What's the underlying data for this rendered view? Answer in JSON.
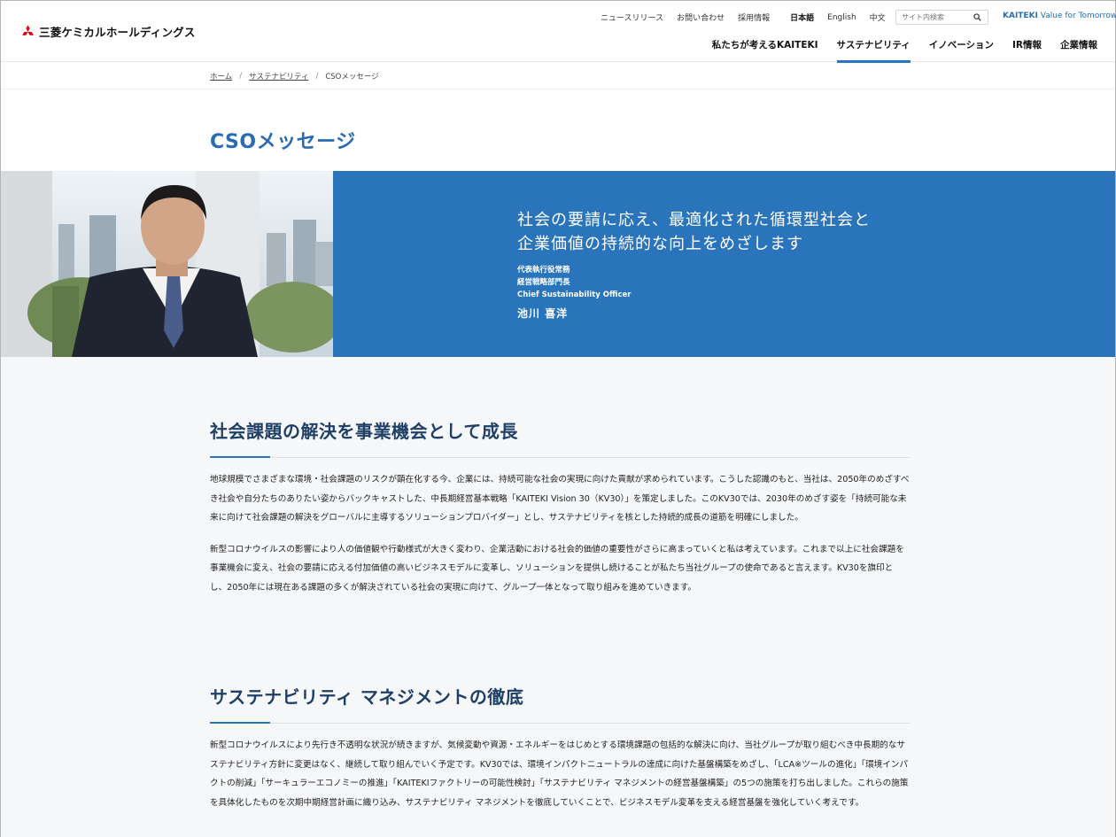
{
  "header": {
    "logo_text": "三菱ケミカルホールディングス",
    "utility_links": [
      "ニュースリリース",
      "お問い合わせ",
      "採用情報"
    ],
    "languages": [
      "日本語",
      "English",
      "中文"
    ],
    "active_language": "日本語",
    "search_placeholder": "サイト内検索",
    "tagline_brand": "KAITEKI",
    "tagline_rest": " Value for Tomorrow",
    "nav": [
      "私たちが考えるKAITEKI",
      "サステナビリティ",
      "イノベーション",
      "IR情報",
      "企業情報"
    ],
    "nav_current": "サステナビリティ"
  },
  "breadcrumb": [
    "ホーム",
    "サステナビリティ",
    "CSOメッセージ"
  ],
  "page_title": "CSOメッセージ",
  "hero": {
    "heading_line1": "社会の要請に応え、最適化された循環型社会と",
    "heading_line2": "企業価値の持続的な向上をめざします",
    "role1": "代表執行役常務",
    "role2": "経営戦略部門長",
    "role3": "Chief Sustainability Officer",
    "name": "池川 喜洋"
  },
  "sections": [
    {
      "heading": "社会課題の解決を事業機会として成長",
      "paragraphs": [
        "地球規模でさまざまな環境・社会課題のリスクが顕在化する今、企業には、持続可能な社会の実現に向けた貢献が求められています。こうした認識のもと、当社は、2050年のめざすべき社会や自分たちのありたい姿からバックキャストした、中長期経営基本戦略「KAITEKI Vision 30（KV30）」を策定しました。このKV30では、2030年のめざす姿を「持続可能な未来に向けて社会課題の解決をグローバルに主導するソリューションプロバイダー」とし、サステナビリティを核とした持続的成長の道筋を明確にしました。",
        "新型コロナウイルスの影響により人の価値観や行動様式が大きく変わり、企業活動における社会的価値の重要性がさらに高まっていくと私は考えています。これまで以上に社会課題を事業機会に変え、社会の要請に応える付加価値の高いビジネスモデルに変革し、ソリューションを提供し続けることが私たち当社グループの使命であると言えます。KV30を旗印とし、2050年には現在ある課題の多くが解決されている社会の実現に向けて、グループ一体となって取り組みを進めていきます。"
      ]
    },
    {
      "heading": "サステナビリティ マネジメントの徹底",
      "paragraphs": [
        "新型コロナウイルスにより先行き不透明な状況が続きますが、気候変動や資源・エネルギーをはじめとする環境課題の包括的な解決に向け、当社グループが取り組むべき中長期的なサステナビリティ方針に変更はなく、継続して取り組んでいく予定です。KV30では、環境インパクトニュートラルの達成に向けた基盤構築をめざし、「LCA※ツールの進化」「環境インパクトの削減」「サーキュラーエコノミーの推進」「KAITEKIファクトリーの可能性検討」「サステナビリティ マネジメントの経営基盤構築」の5つの施策を打ち出しました。これらの施策を具体化したものを次期中期経営計画に織り込み、サステナビリティ マネジメントを徹底していくことで、ビジネスモデル変革を支える経営基盤を強化していく考えです。"
      ]
    }
  ],
  "colors": {
    "brand_blue": "#2a74bc",
    "title_blue": "#2a6bb2",
    "heading_navy": "#1f3f66",
    "logo_red": "#e60012"
  }
}
